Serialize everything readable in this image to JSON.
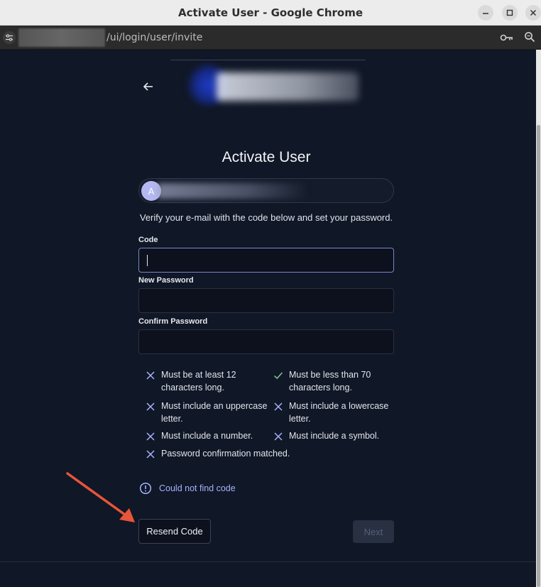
{
  "window": {
    "title": "Activate User - Google Chrome"
  },
  "browser": {
    "url_path": "/ui/login/user/invite"
  },
  "page": {
    "title": "Activate User",
    "user_avatar_letter": "A",
    "instructions": "Verify your e-mail with the code below and set your password.",
    "fields": {
      "code_label": "Code",
      "new_password_label": "New Password",
      "confirm_password_label": "Confirm Password"
    },
    "requirements": [
      {
        "text_line1": "Must be at least 12",
        "text_line2": "characters long.",
        "status": "unmet"
      },
      {
        "text_line1": "Must be less than 70",
        "text_line2": "characters long.",
        "status": "met"
      },
      {
        "text_line1": "Must include an uppercase",
        "text_line2": "letter.",
        "status": "unmet"
      },
      {
        "text_line1": "Must include a lowercase",
        "text_line2": "letter.",
        "status": "unmet"
      },
      {
        "text_line1": "Must include a number.",
        "status": "unmet"
      },
      {
        "text_line1": "Must include a symbol.",
        "status": "unmet"
      },
      {
        "text_line1": "Password confirmation matched.",
        "status": "unmet"
      }
    ],
    "error_message": "Could not find code",
    "buttons": {
      "resend": "Resend Code",
      "next": "Next"
    }
  },
  "colors": {
    "background": "#101726",
    "accent": "#a7b2ff",
    "met": "#7ec99a",
    "annotation_arrow": "#e8553a"
  }
}
